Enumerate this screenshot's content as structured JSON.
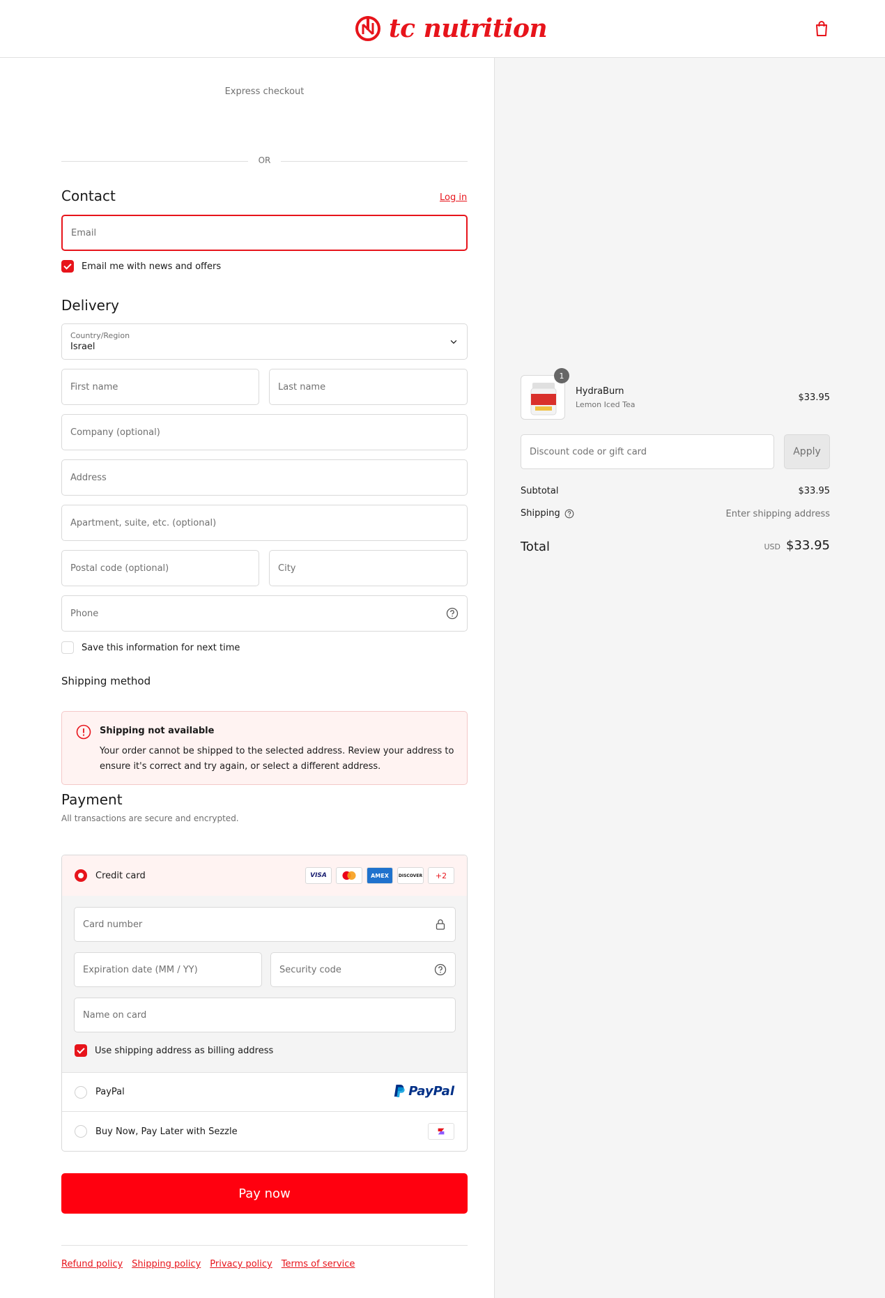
{
  "header": {
    "brand": "tc nutrition",
    "brand_color": "#e7141b"
  },
  "express": {
    "label": "Express checkout",
    "separator": "OR"
  },
  "contact": {
    "title": "Contact",
    "login_link": "Log in",
    "email_placeholder": "Email",
    "news_label": "Email me with news and offers"
  },
  "delivery": {
    "title": "Delivery",
    "country_label": "Country/Region",
    "country_value": "Israel",
    "first_name": "First name",
    "last_name": "Last name",
    "company": "Company (optional)",
    "address": "Address",
    "apartment": "Apartment, suite, etc. (optional)",
    "postal": "Postal code (optional)",
    "city": "City",
    "phone": "Phone",
    "save_info": "Save this information for next time"
  },
  "shipping_method": {
    "title": "Shipping method",
    "alert_title": "Shipping not available",
    "alert_body": "Your order cannot be shipped to the selected address. Review your address to ensure it's correct and try again, or select a different address."
  },
  "payment": {
    "title": "Payment",
    "subtitle": "All transactions are secure and encrypted.",
    "credit_card": "Credit card",
    "cards": [
      "VISA",
      "MC",
      "AMEX",
      "DISCOVER"
    ],
    "more_cards": "+2",
    "card_number": "Card number",
    "expiration": "Expiration date (MM / YY)",
    "security": "Security code",
    "name_on_card": "Name on card",
    "billing_same": "Use shipping address as billing address",
    "paypal": "PayPal",
    "paypal_logo": "PayPal",
    "sezzle": "Buy Now, Pay Later with Sezzle"
  },
  "pay_button": "Pay now",
  "footer": {
    "links": [
      "Refund policy",
      "Shipping policy",
      "Privacy policy",
      "Terms of service"
    ]
  },
  "summary": {
    "qty": "1",
    "product_name": "HydraBurn",
    "product_variant": "Lemon Iced Tea",
    "product_price": "$33.95",
    "discount_placeholder": "Discount code or gift card",
    "apply": "Apply",
    "subtotal_label": "Subtotal",
    "subtotal_value": "$33.95",
    "shipping_label": "Shipping",
    "shipping_value": "Enter shipping address",
    "total_label": "Total",
    "currency": "USD",
    "total_value": "$33.95"
  }
}
